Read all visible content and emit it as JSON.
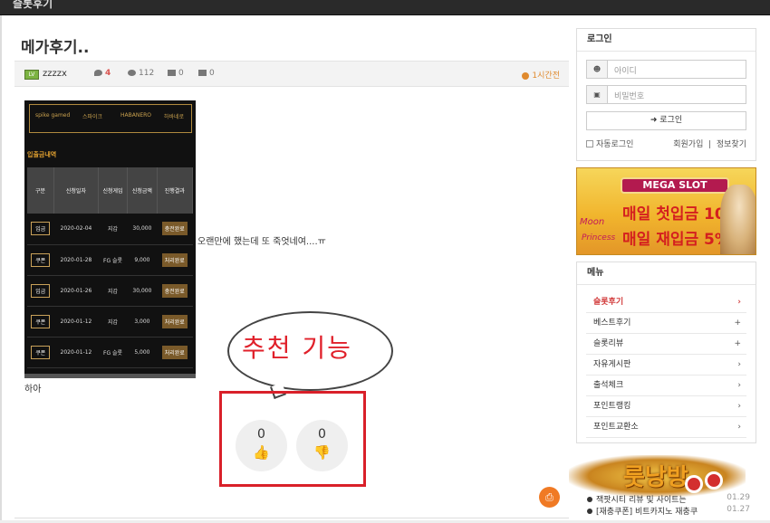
{
  "header": {
    "board_title": "슬롯후기"
  },
  "post": {
    "title": "메가후기..",
    "author": "zzzzx",
    "level_badge": "LV",
    "comments": "4",
    "views": "112",
    "upvotes": "0",
    "downvotes": "0",
    "time": "1시간전",
    "body_text": "오랜만에 했는데 또 죽엇네여....ㅠ",
    "body_text2": "하아"
  },
  "post_image": {
    "tiles": [
      "spike gamed",
      "스파이크",
      "HABANERO",
      "하바네로"
    ],
    "section_title": "입출금내역",
    "headers": [
      "구분",
      "신청일자",
      "신청게임",
      "신청금액",
      "진행결과"
    ],
    "rows": [
      {
        "type": "입금",
        "date": "2020-02-04",
        "game": "지갑",
        "amount": "30,000",
        "status": "충전완료"
      },
      {
        "type": "쿠폰",
        "date": "2020-01-28",
        "game": "FG 슬롯",
        "amount": "9,000",
        "status": "처리완료"
      },
      {
        "type": "입금",
        "date": "2020-01-26",
        "game": "지갑",
        "amount": "30,000",
        "status": "충전완료"
      },
      {
        "type": "쿠폰",
        "date": "2020-01-12",
        "game": "지갑",
        "amount": "3,000",
        "status": "처리완료"
      },
      {
        "type": "쿠폰",
        "date": "2020-01-12",
        "game": "FG 슬롯",
        "amount": "5,000",
        "status": "처리완료"
      }
    ]
  },
  "annotation": {
    "bubble_text": "추천 기능"
  },
  "recommend": {
    "up_count": "0",
    "down_count": "0",
    "up_icon": "thumbs-up-icon",
    "down_icon": "thumbs-down-icon"
  },
  "login": {
    "title": "로그인",
    "id_placeholder": "아이디",
    "pw_placeholder": "비밀번호",
    "login_button": "로그인",
    "auto_login": "자동로그인",
    "join": "회원가입",
    "separator": "|",
    "find": "정보찾기"
  },
  "banner": {
    "logo": "MEGA SLOT",
    "line1": "매일 첫입금 10%",
    "line2": "매일 재입금 5%",
    "side1": "Moon",
    "side2": "Princess"
  },
  "menu": {
    "title": "메뉴",
    "items": [
      {
        "label": "슬롯후기",
        "arrow": "›"
      },
      {
        "label": "베스트후기",
        "arrow": "+"
      },
      {
        "label": "슬롯리뷰",
        "arrow": "+"
      },
      {
        "label": "자유게시판",
        "arrow": "›"
      },
      {
        "label": "출석체크",
        "arrow": "›"
      },
      {
        "label": "포인트랭킹",
        "arrow": "›"
      },
      {
        "label": "포인트교환소",
        "arrow": "›"
      }
    ]
  },
  "promo": {
    "text": "룻낭방"
  },
  "latest": [
    {
      "title": "잭팟시티 리뷰 및 사이트는",
      "time": "01.29"
    },
    {
      "title": "[재충쿠폰] 비트카지노 재충쿠",
      "time": "01.27"
    }
  ],
  "colors": {
    "accent": "#d23c3c",
    "orange": "#f07a24",
    "red_box": "#d92029"
  }
}
